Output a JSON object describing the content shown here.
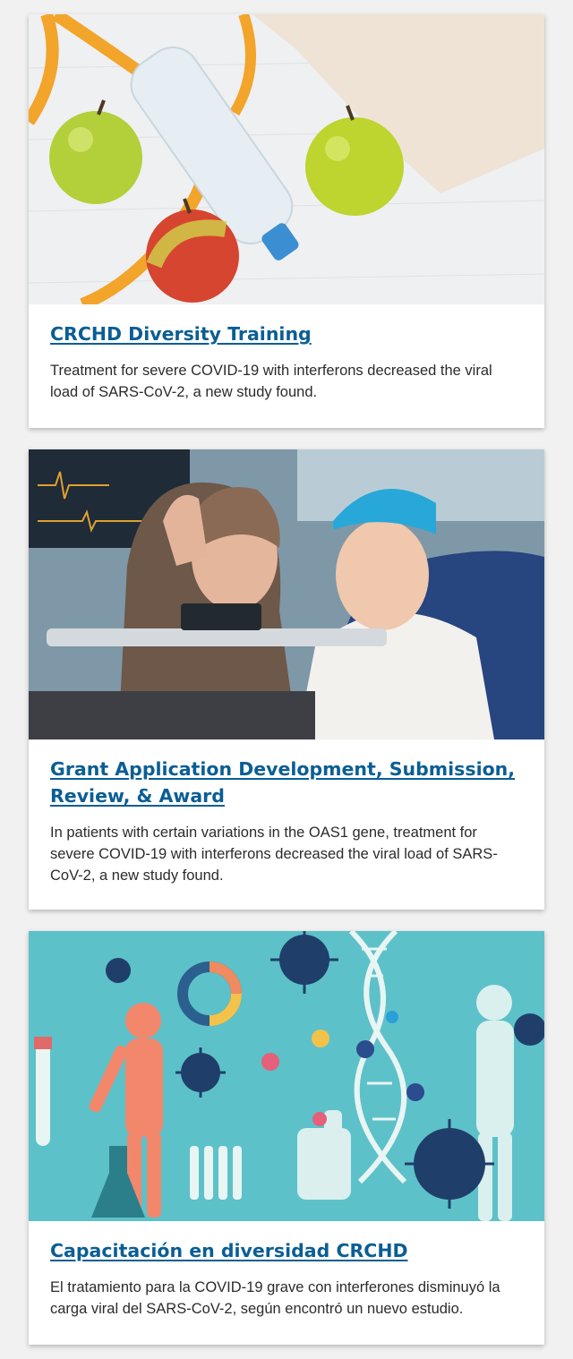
{
  "cards": [
    {
      "image_alt": "Green and red apples, a water bottle, a measuring tape and a towel on a white wooden table",
      "title": "CRCHD Diversity Training",
      "description": "Treatment for severe COVID-19 with interferons decreased the viral load of SARS-CoV-2, a new study found."
    },
    {
      "image_alt": "A smiling woman and a child in a blue head wrap waving at a tablet in a hospital bed",
      "title": "Grant Application Development, Submission, Review, & Award",
      "description": "In patients with certain variations in the OAS1 gene, treatment for severe COVID-19 with interferons decreased the viral load of SARS-CoV-2, a new study found."
    },
    {
      "image_alt": "Illustration of viruses, DNA helix, human figures, lab equipment and charts on a teal background",
      "title": "Capacitación en diversidad CRCHD",
      "description": "El tratamiento para la COVID-19 grave con interferones disminuyó la carga viral del SARS-CoV-2, según encontró un nuevo estudio."
    }
  ]
}
